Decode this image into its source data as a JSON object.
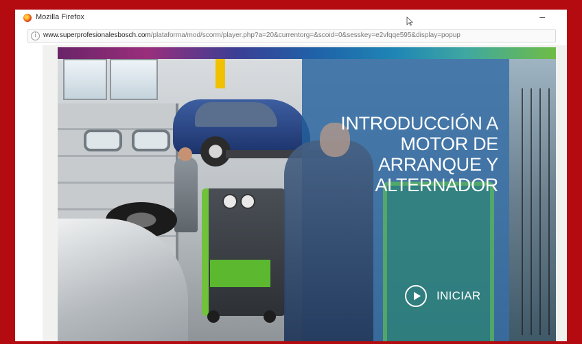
{
  "window": {
    "title": "Mozilla Firefox",
    "minimize_glyph": "–"
  },
  "addressbar": {
    "domain": "www.superprofesionalesbosch.com",
    "path": "/plataforma/mod/scorm/player.php?a=20&currentorg=&scoid=0&sesskey=e2vfqqe595&display=popup",
    "info_glyph": "i"
  },
  "slide": {
    "title_lines": [
      "INTRODUCCIÓN A",
      "MOTOR DE",
      "ARRANQUE Y",
      "ALTERNADOR"
    ],
    "start_label": "INICIAR"
  },
  "theme": {
    "frame_border": "#b30b10",
    "overlay_blue": "#22609c"
  },
  "icons": [
    "firefox-icon",
    "minimize-icon",
    "info-icon",
    "play-icon"
  ]
}
